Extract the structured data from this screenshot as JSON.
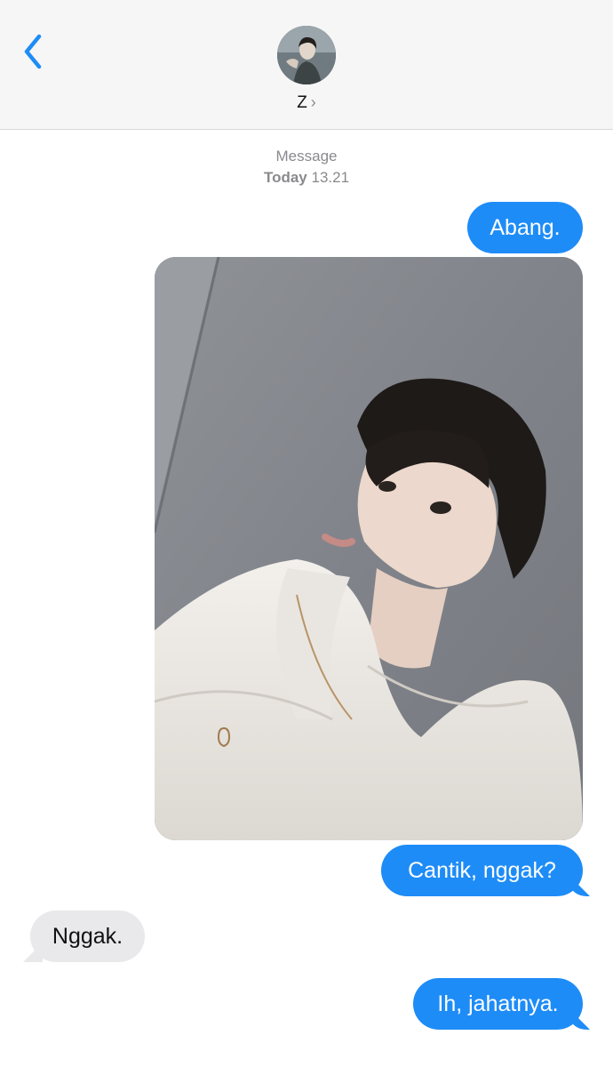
{
  "header": {
    "back_icon": "chevron-left-icon",
    "avatar_icon": "contact-avatar",
    "contact_name": "Z",
    "contact_chevron": "›"
  },
  "thread": {
    "service_label": "Message",
    "date_label": "Today",
    "time_label": "13.21"
  },
  "messages": [
    {
      "direction": "sent",
      "text": "Abang."
    },
    {
      "direction": "sent",
      "type": "photo",
      "image": "selfie-photo"
    },
    {
      "direction": "sent",
      "text": "Cantik, nggak?"
    },
    {
      "direction": "received",
      "text": "Nggak."
    },
    {
      "direction": "sent",
      "text": "Ih, jahatnya."
    }
  ],
  "colors": {
    "accent": "#1e8cf7",
    "received_bubble": "#e9e9eb",
    "header_bg": "#f6f6f6"
  }
}
